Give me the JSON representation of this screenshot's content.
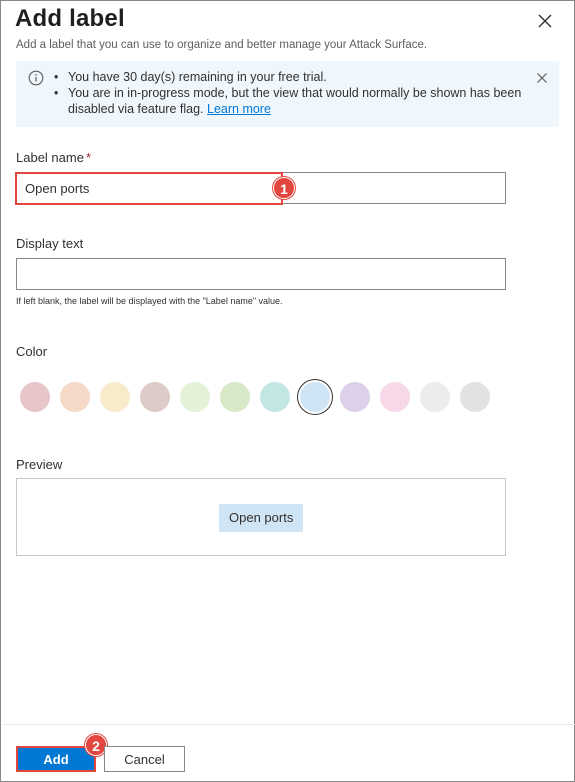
{
  "panel": {
    "title": "Add label",
    "subtitle": "Add a label that you can use to organize and better manage your Attack Surface.",
    "close_icon": "close-icon"
  },
  "banner": {
    "icon": "info-icon",
    "line1": "You have 30 day(s) remaining in your free trial.",
    "line2": "You are in in-progress mode, but the view that would normally be shown has been disabled via feature flag.",
    "link": "Learn more",
    "close_icon": "close-icon"
  },
  "label_name": {
    "label": "Label name",
    "required_mark": "*",
    "value": "Open ports"
  },
  "display_text": {
    "label": "Display text",
    "value": "",
    "helper": "If left blank, the label will be displayed with the \"Label name\" value."
  },
  "color": {
    "label": "Color",
    "swatches": [
      "#e8c5c9",
      "#f4d9c9",
      "#f7ebc9",
      "#dccbc6",
      "#e3f1d6",
      "#d7e8c8",
      "#c2e6e4",
      "#cfe4f5",
      "#dcd0ea",
      "#f7d8e8",
      "#ebeced",
      "#e2e2e2"
    ],
    "selected_index": 7
  },
  "preview": {
    "label": "Preview",
    "chip_text": "Open ports",
    "chip_color": "#cfe4f5"
  },
  "footer": {
    "add_label": "Add",
    "cancel_label": "Cancel"
  },
  "annotations": {
    "step1": "1",
    "step2": "2",
    "highlight_color": "#e3463e"
  }
}
